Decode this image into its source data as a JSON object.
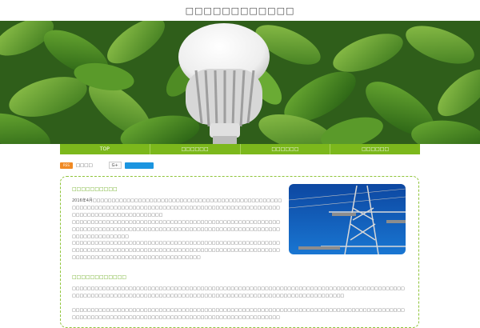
{
  "site": {
    "title": "□□□□□□□□□□□□"
  },
  "hero": {
    "alt": "hero-banner"
  },
  "nav": {
    "items": [
      {
        "label": "TOP"
      },
      {
        "label": "□□□□□□"
      },
      {
        "label": "□□□□□□"
      },
      {
        "label": "□□□□□□"
      }
    ]
  },
  "share": {
    "rss_label": "RSS",
    "feedly_label": "□□□□",
    "gplus_label": "G+"
  },
  "article": {
    "section1": {
      "heading": "□□□□□□□□□□",
      "paragraphs": [
        "2016年4月□□□□□□□□□□□□□□□□□□□□□□□□□□□□□□□□□□□□□□□□□□□□□□□□□□□□□□□□□□□□□□□□□□□□□□□□□□□□□□□□□□□□□□□□□□□□□□□□□□□□□□□□□□□□□□□□□□□□□□□□□□□□□□□□□",
        "□□□□□□□□□□□□□□□□□□□□□□□□□□□□□□□□□□□□□□□□□□□□□□□□□□□□□□□□□□□□□□□□□□□□□□□□□□□□□□□□□□□□□□□□□□□□□□□□□□□□□□□□□□□□□□□□□□□□□□□□□□□□□",
        "□□□□□□□□□□□□□□□□□□□□□□□□□□□□□□□□□□□□□□□□□□□□□□□□□□□□□□□□□□□□□□□□□□□□□□□□□□□□□□□□□□□□□□□□□□□□□□□□□□□□□□□□□□□□□□□□□□□□□□□□□□□□□□□□□□□□□□□□□□□□□□□□"
      ]
    },
    "section2": {
      "heading": "□□□□□□□□□□□□",
      "paragraphs": [
        "□□□□□□□□□□□□□□□□□□□□□□□□□□□□□□□□□□□□□□□□□□□□□□□□□□□□□□□□□□□□□□□□□□□□□□□□□□□□□□□□□□□□□□□□□□□□□□□□□□□□□□□□□□□□□□□□□□□□□□□□□□□□□□□□□□□□□□□□□□□□□□□□□□□□□□□□□□□□□□□□",
        "□□□□□□□□□□□□□□□□□□□□□□□□□□□□□□□□□□□□□□□□□□□□□□□□□□□□□□□□□□□□□□□□□□□□□□□□□□□□□□□□□□□□□□□□□□□□□□□□□□□□□□□□□□□□□□□□□□□□□□□□□□□□□□□□□□□□□□□□□□□□□□□"
      ]
    }
  },
  "colors": {
    "accent": "#7cb81c",
    "heading": "#6aab1c",
    "border": "#8fc43a",
    "rss": "#f08a24",
    "share": "#1b95e0"
  }
}
